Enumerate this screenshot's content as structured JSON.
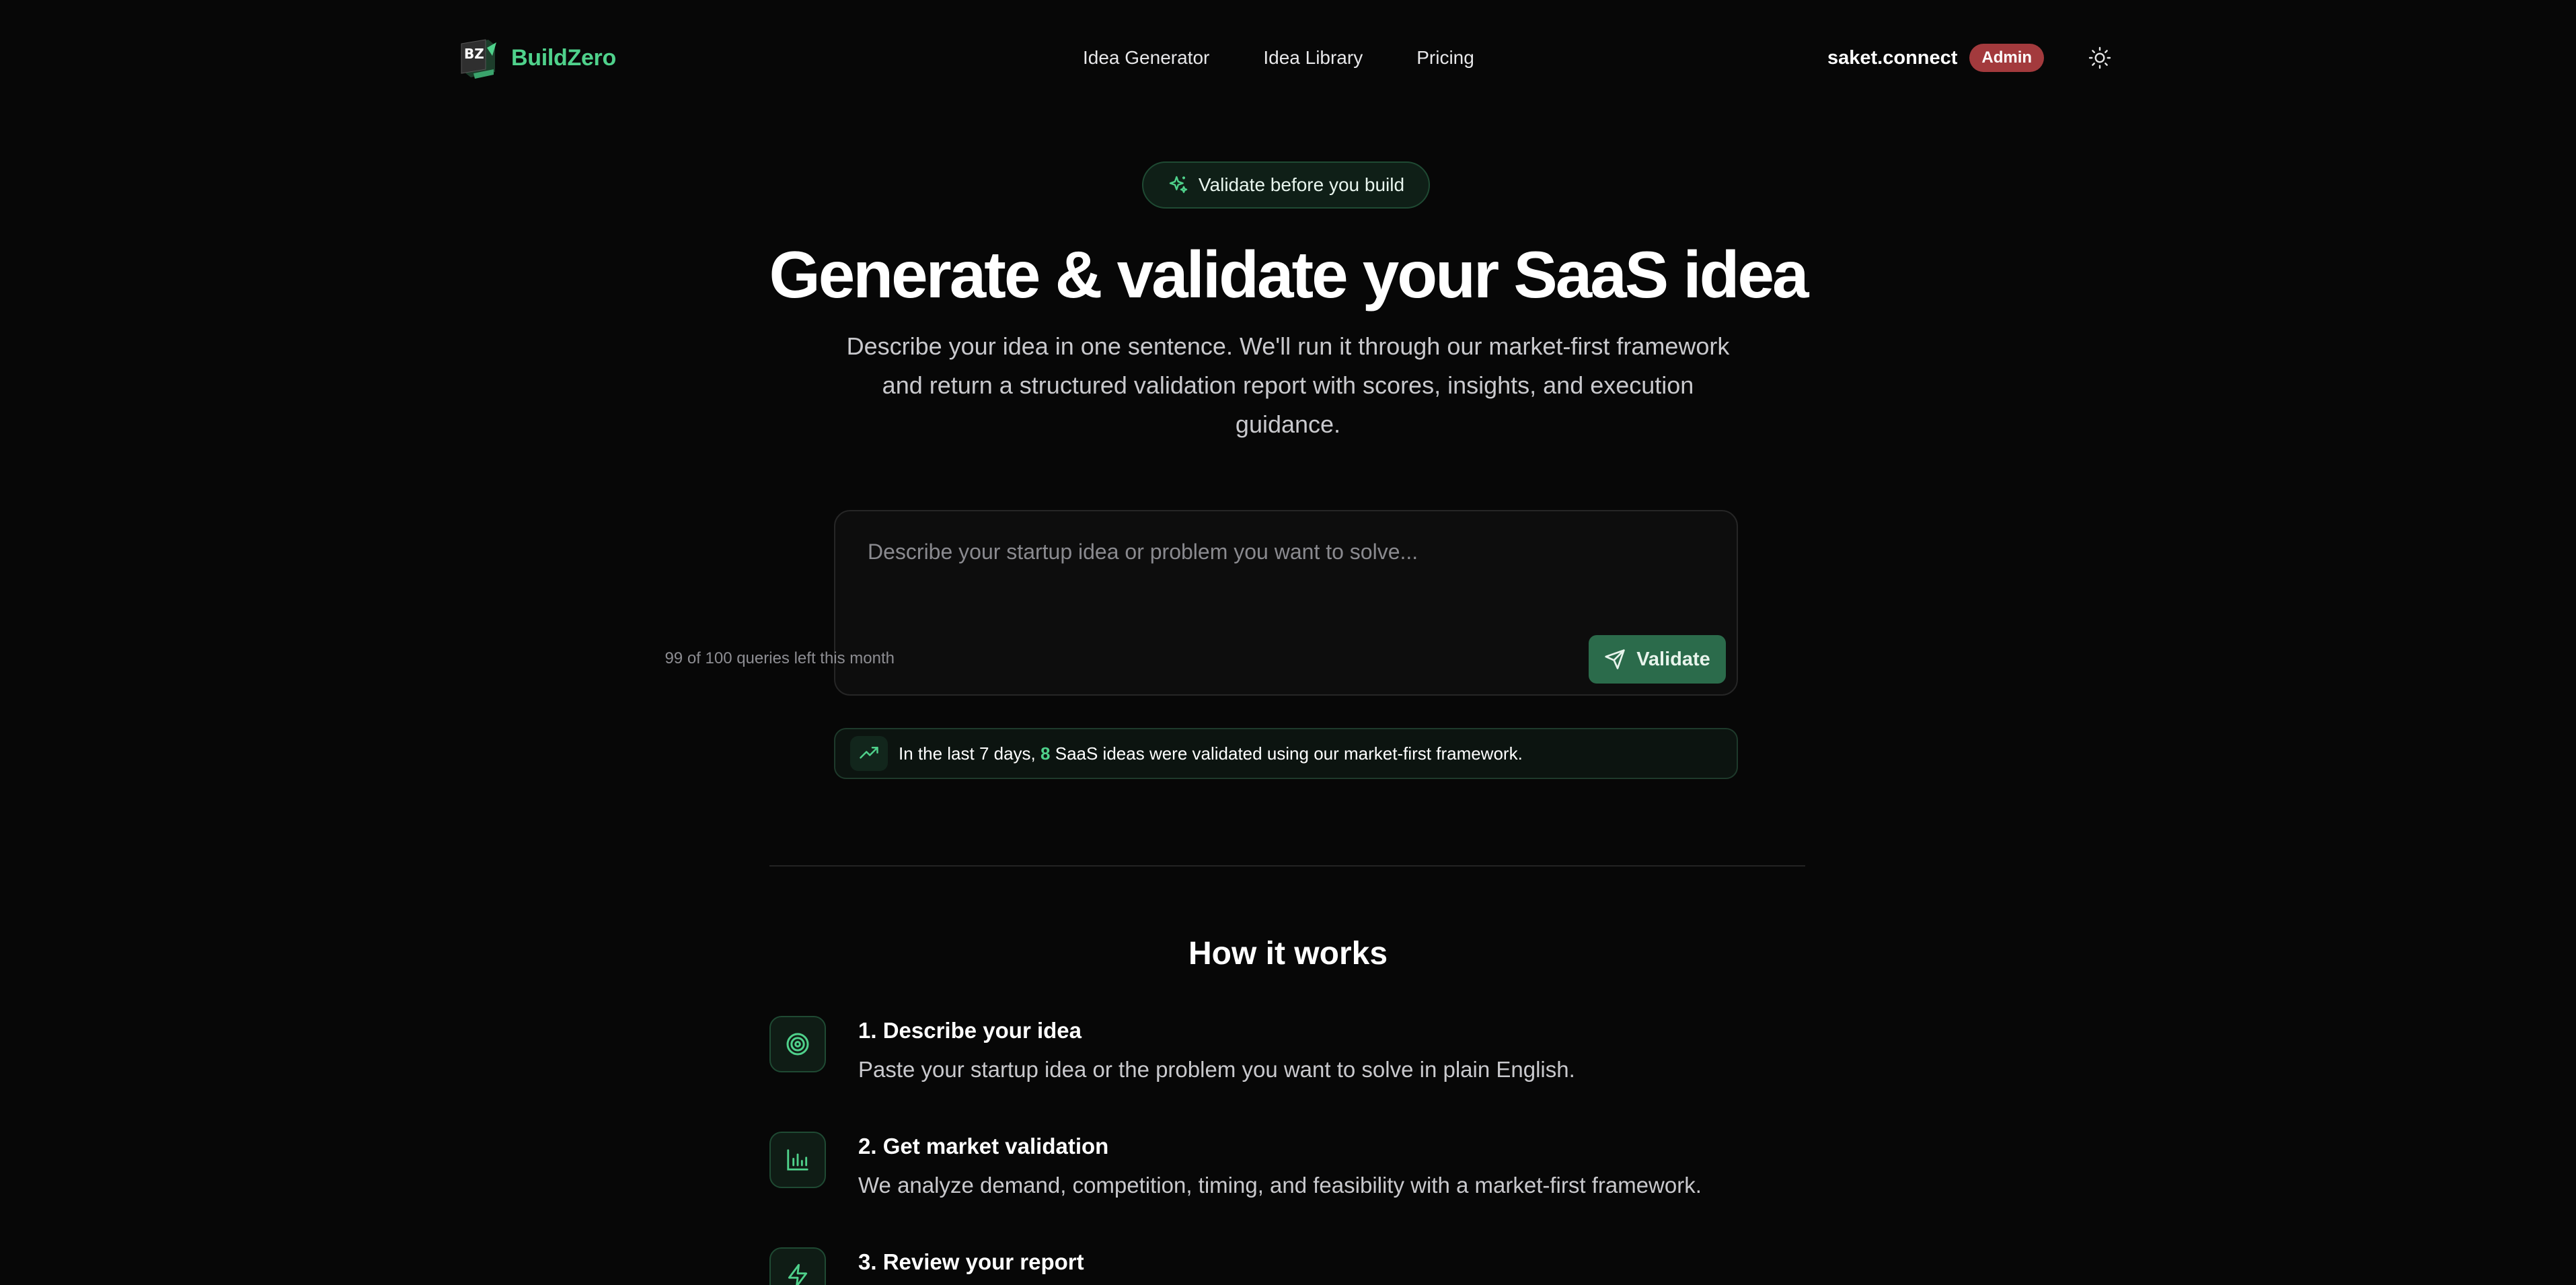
{
  "header": {
    "brand": {
      "part1": "Build",
      "part2": "Zero",
      "mark_text": "BZ"
    },
    "nav": [
      {
        "label": "Idea Generator"
      },
      {
        "label": "Idea Library"
      },
      {
        "label": "Pricing"
      }
    ],
    "user": {
      "name": "saket.connect",
      "role_badge": "Admin"
    },
    "theme_toggle_icon": "sun-icon"
  },
  "hero": {
    "pill_label": "Validate before you build",
    "pill_icon": "sparkles-icon",
    "title": "Generate & validate your SaaS idea",
    "subtitle": "Describe your idea in one sentence. We'll run it through our market-first framework and return a structured validation report with scores, insights, and execution guidance."
  },
  "idea_form": {
    "placeholder": "Describe your startup idea or problem you want to solve...",
    "value": "",
    "quota_text": "99 of 100 queries left this month",
    "submit_label": "Validate",
    "submit_icon": "send-icon"
  },
  "stat": {
    "icon": "trending-up-icon",
    "prefix": "In the last 7 days,",
    "count": "8",
    "suffix": "SaaS ideas were validated using our market-first framework."
  },
  "how_it_works": {
    "title": "How it works",
    "steps": [
      {
        "icon": "target-icon",
        "title": "1. Describe your idea",
        "description": "Paste your startup idea or the problem you want to solve in plain English."
      },
      {
        "icon": "bar-chart-icon",
        "title": "2. Get market validation",
        "description": "We analyze demand, competition, timing, and feasibility with a market-first framework."
      },
      {
        "icon": "zap-icon",
        "title": "3. Review your report",
        "description": ""
      }
    ]
  },
  "colors": {
    "background": "#070707",
    "accent": "#4fd18b",
    "button": "#2b6b4b",
    "badge": "#a33a3d"
  }
}
